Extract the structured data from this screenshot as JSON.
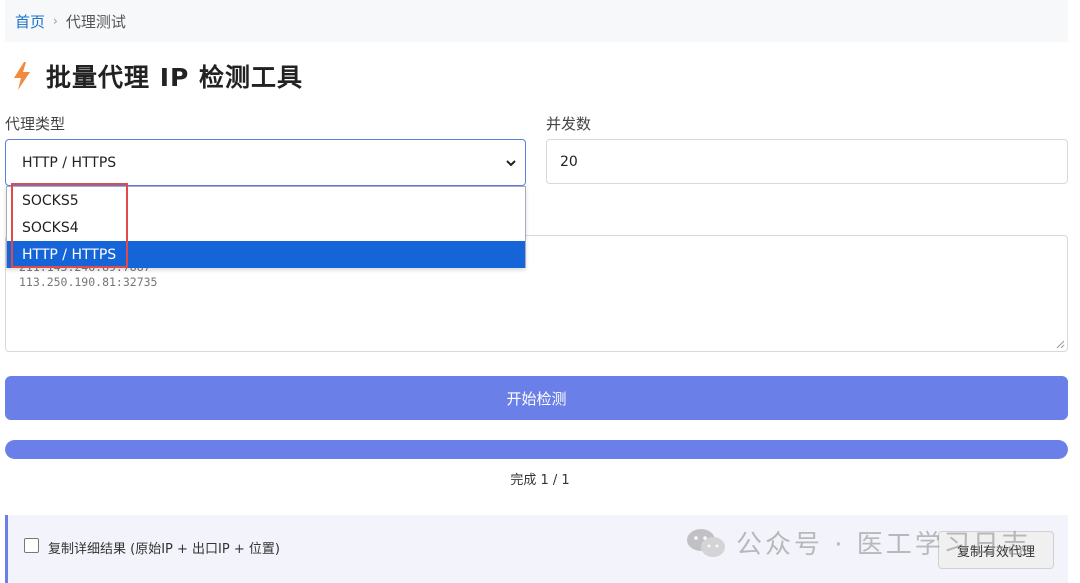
{
  "breadcrumb": {
    "home": "首页",
    "separator": "›",
    "current": "代理测试"
  },
  "page": {
    "title": "批量代理 IP 检测工具",
    "title_icon": "lightning-bolt-icon"
  },
  "form": {
    "proxy_type_label": "代理类型",
    "proxy_type_value": "HTTP / HTTPS",
    "concurrency_label": "并发数",
    "concurrency_value": "20",
    "options": [
      "SOCKS5",
      "SOCKS4",
      "HTTP / HTTPS"
    ],
    "selected_option": "HTTP / HTTPS",
    "proxy_list_partial": "211.143.246.89:7887",
    "proxy_list_line2": "113.250.190.81:32735"
  },
  "actions": {
    "start_label": "开始检测",
    "copy_valid_label": "复制有效代理"
  },
  "progress": {
    "fraction": 1.0,
    "status": "完成 1 / 1"
  },
  "results": {
    "copy_details_label": "复制详细结果 (原始IP + 出口IP + 位置)"
  },
  "watermark": {
    "text": "公众号 · 医工学习日志"
  },
  "colors": {
    "accent": "#6b7fe8",
    "link": "#1a73c8",
    "selected": "#1565d8",
    "highlight": "#e04a4a"
  }
}
